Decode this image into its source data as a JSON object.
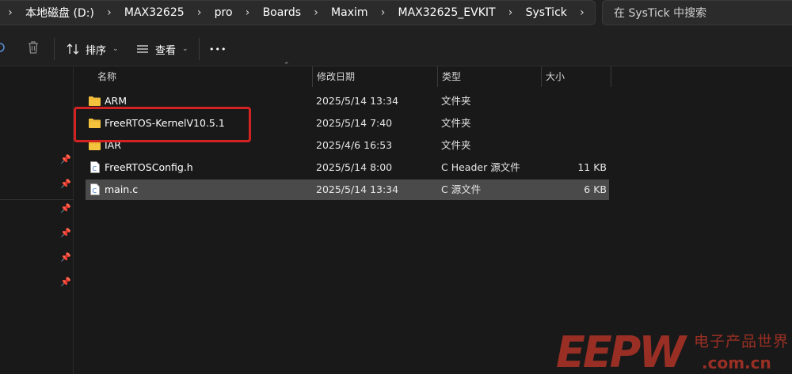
{
  "breadcrumb": [
    "本地磁盘 (D:)",
    "MAX32625",
    "pro",
    "Boards",
    "Maxim",
    "MAX32625_EVKIT",
    "SysTick"
  ],
  "search": {
    "placeholder": "在 SysTick 中搜索"
  },
  "toolbar": {
    "sort_label": "排序",
    "view_label": "查看",
    "more_label": "•••",
    "delete_icon": "trash-icon"
  },
  "columns": {
    "name": "名称",
    "date": "修改日期",
    "type": "类型",
    "size": "大小"
  },
  "files": [
    {
      "name": "ARM",
      "date": "2025/5/14 13:34",
      "type": "文件夹",
      "size": "",
      "icon": "folder-icon"
    },
    {
      "name": "FreeRTOS-KernelV10.5.1",
      "date": "2025/5/14 7:40",
      "type": "文件夹",
      "size": "",
      "icon": "folder-icon"
    },
    {
      "name": "IAR",
      "date": "2025/4/6 16:53",
      "type": "文件夹",
      "size": "",
      "icon": "folder-icon"
    },
    {
      "name": "FreeRTOSConfig.h",
      "date": "2025/5/14 8:00",
      "type": "C Header 源文件",
      "size": "11 KB",
      "icon": "c-header-file-icon"
    },
    {
      "name": "main.c",
      "date": "2025/5/14 13:34",
      "type": "C 源文件",
      "size": "6 KB",
      "icon": "c-source-file-icon"
    }
  ],
  "selected_file": "main.c",
  "highlighted_file": "FreeRTOS-KernelV10.5.1",
  "watermark": {
    "brand": "EEPW",
    "tagline": "电子产品世界",
    "url": ".com.cn"
  },
  "colors": {
    "highlight": "#d32222",
    "selection": "#4a4a4a",
    "folder": "#f5c23e",
    "watermark": "#c0392b"
  }
}
